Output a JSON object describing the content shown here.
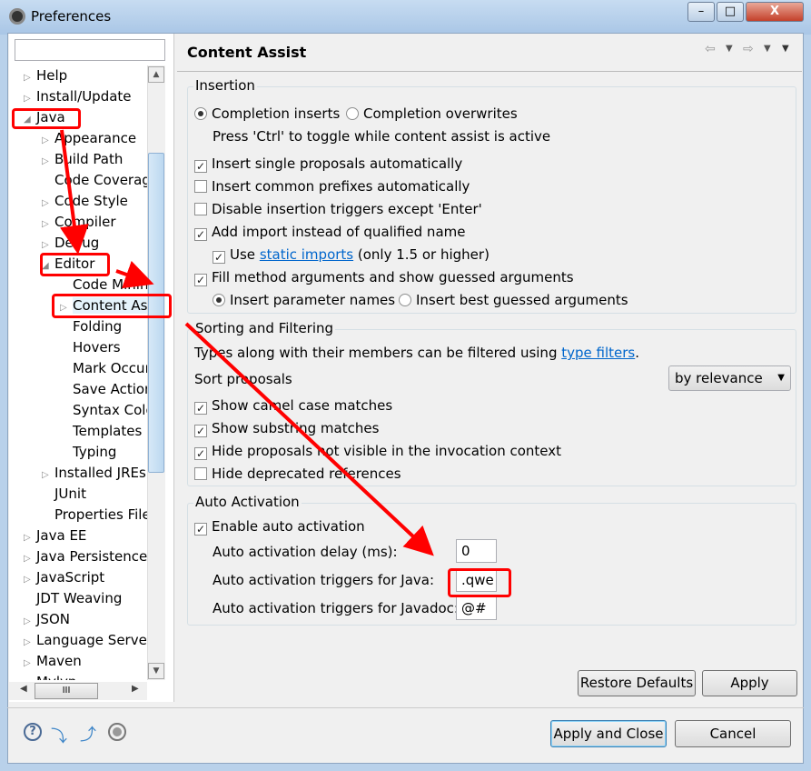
{
  "window": {
    "title": "Preferences",
    "minimize": "–",
    "maximize": "□",
    "close": "X"
  },
  "filter": {
    "value": "",
    "placeholder": ""
  },
  "tree": [
    {
      "label": "Help",
      "level": 0,
      "twisty": "collapsed"
    },
    {
      "label": "Install/Update",
      "level": 0,
      "twisty": "collapsed"
    },
    {
      "label": "Java",
      "level": 0,
      "twisty": "expanded"
    },
    {
      "label": "Appearance",
      "level": 1,
      "twisty": "collapsed"
    },
    {
      "label": "Build Path",
      "level": 1,
      "twisty": "collapsed"
    },
    {
      "label": "Code Coverage",
      "level": 1,
      "twisty": "none"
    },
    {
      "label": "Code Style",
      "level": 1,
      "twisty": "collapsed"
    },
    {
      "label": "Compiler",
      "level": 1,
      "twisty": "collapsed"
    },
    {
      "label": "Debug",
      "level": 1,
      "twisty": "collapsed"
    },
    {
      "label": "Editor",
      "level": 1,
      "twisty": "expanded"
    },
    {
      "label": "Code Minings",
      "level": 2,
      "twisty": "none"
    },
    {
      "label": "Content Assist",
      "level": 2,
      "twisty": "collapsed",
      "selected": true
    },
    {
      "label": "Folding",
      "level": 2,
      "twisty": "none"
    },
    {
      "label": "Hovers",
      "level": 2,
      "twisty": "none"
    },
    {
      "label": "Mark Occurrences",
      "level": 2,
      "twisty": "none"
    },
    {
      "label": "Save Actions",
      "level": 2,
      "twisty": "none"
    },
    {
      "label": "Syntax Coloring",
      "level": 2,
      "twisty": "none"
    },
    {
      "label": "Templates",
      "level": 2,
      "twisty": "none"
    },
    {
      "label": "Typing",
      "level": 2,
      "twisty": "none"
    },
    {
      "label": "Installed JREs",
      "level": 1,
      "twisty": "collapsed"
    },
    {
      "label": "JUnit",
      "level": 1,
      "twisty": "none"
    },
    {
      "label": "Properties Files Editor",
      "level": 1,
      "twisty": "none"
    },
    {
      "label": "Java EE",
      "level": 0,
      "twisty": "collapsed"
    },
    {
      "label": "Java Persistence",
      "level": 0,
      "twisty": "collapsed"
    },
    {
      "label": "JavaScript",
      "level": 0,
      "twisty": "collapsed"
    },
    {
      "label": "JDT Weaving",
      "level": 0,
      "twisty": "none"
    },
    {
      "label": "JSON",
      "level": 0,
      "twisty": "collapsed"
    },
    {
      "label": "Language Servers",
      "level": 0,
      "twisty": "collapsed"
    },
    {
      "label": "Maven",
      "level": 0,
      "twisty": "collapsed"
    },
    {
      "label": "Mylyn",
      "level": 0,
      "twisty": "collapsed"
    }
  ],
  "page": {
    "title": "Content Assist",
    "insertion": {
      "label": "Insertion",
      "completion_inserts": "Completion inserts",
      "completion_overwrites": "Completion overwrites",
      "toggle_hint": "Press 'Ctrl' to toggle while content assist is active",
      "insert_single": "Insert single proposals automatically",
      "insert_common": "Insert common prefixes automatically",
      "disable_triggers": "Disable insertion triggers except 'Enter'",
      "add_import": "Add import instead of qualified name",
      "use_prefix": "Use",
      "static_imports": "static imports",
      "use_suffix": "(only 1.5 or higher)",
      "fill_args": "Fill method arguments and show guessed arguments",
      "insert_param_names": "Insert parameter names",
      "insert_best_guessed": "Insert best guessed arguments"
    },
    "sorting": {
      "label": "Sorting and Filtering",
      "types_prefix": "Types along with their members can be filtered using",
      "type_filters": "type filters",
      "types_suffix": ".",
      "sort_label": "Sort proposals",
      "sort_value": "by relevance",
      "camel": "Show camel case matches",
      "substring": "Show substring matches",
      "hide_not_visible": "Hide proposals not visible in the invocation context",
      "hide_deprecated": "Hide deprecated references"
    },
    "auto": {
      "label": "Auto Activation",
      "enable": "Enable auto activation",
      "delay_label": "Auto activation delay (ms):",
      "delay_value": "0",
      "java_label": "Auto activation triggers for Java:",
      "java_value": ".qwe",
      "javadoc_label": "Auto activation triggers for Javadoc:",
      "javadoc_value": "@#"
    },
    "restore_defaults": "Restore Defaults",
    "apply": "Apply"
  },
  "footer": {
    "apply_close": "Apply and Close",
    "cancel": "Cancel"
  },
  "colors": {
    "annotation": "#ff0000",
    "link": "#0066cc"
  }
}
